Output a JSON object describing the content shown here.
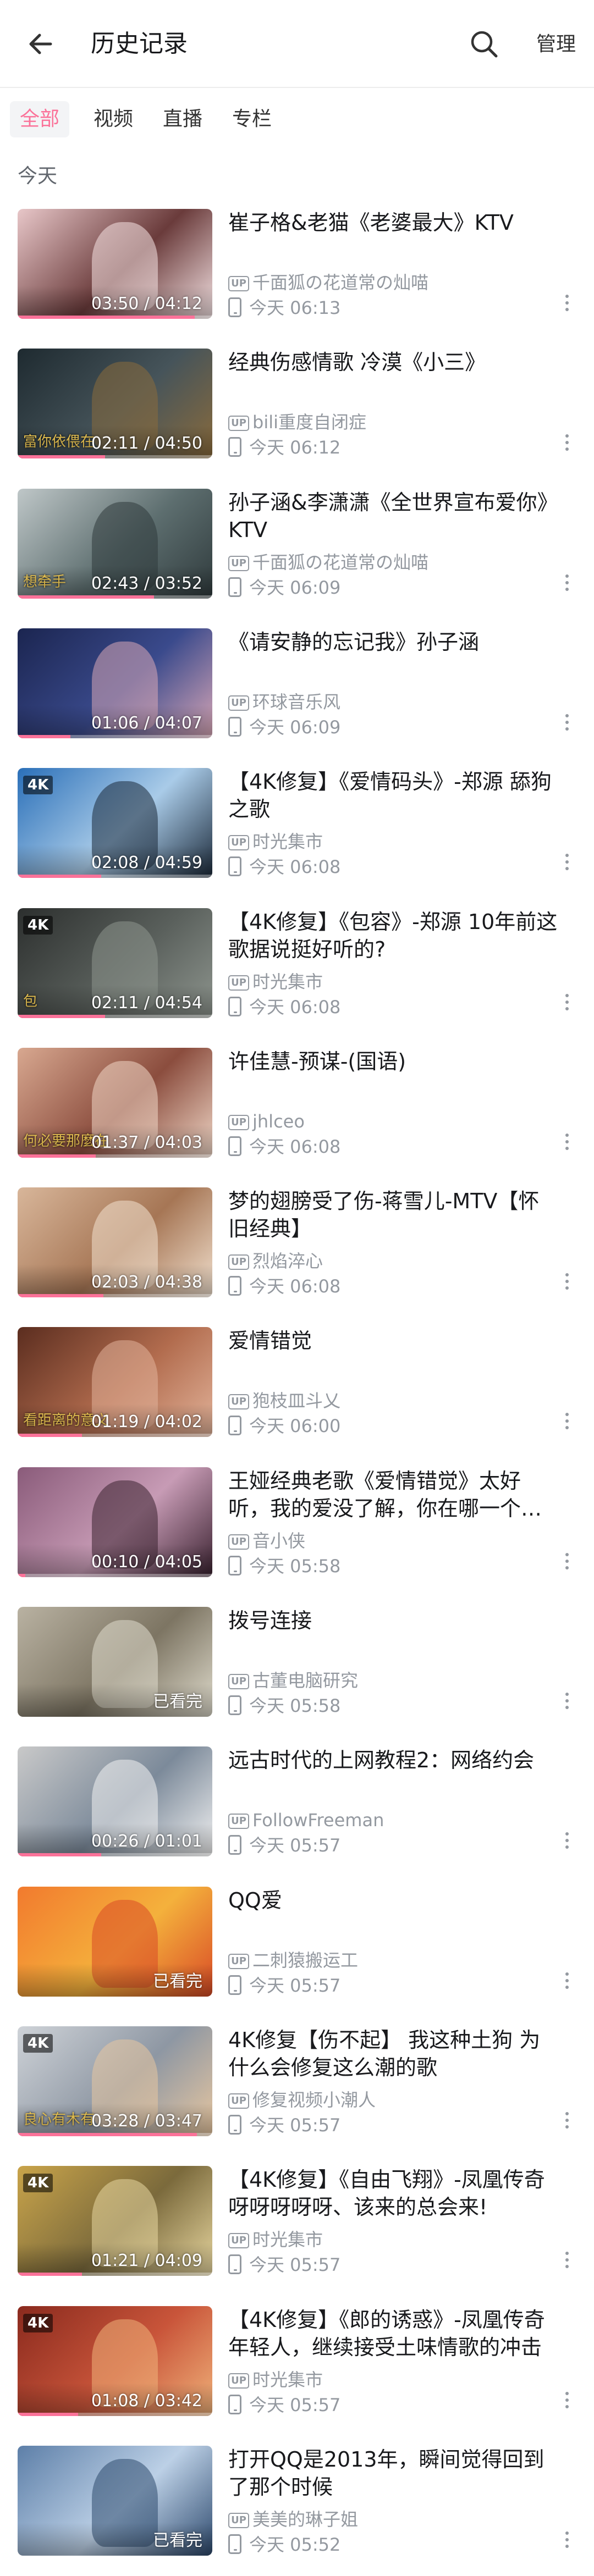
{
  "header": {
    "title": "历史记录",
    "manage_label": "管理",
    "back_icon": "arrow-left-icon",
    "search_icon": "search-icon"
  },
  "tabs": [
    {
      "label": "全部",
      "active": true
    },
    {
      "label": "视频",
      "active": false
    },
    {
      "label": "直播",
      "active": false
    },
    {
      "label": "专栏",
      "active": false
    }
  ],
  "section": {
    "label": "今天"
  },
  "colors": {
    "accent": "#fb7299",
    "meta": "#9499a0",
    "title": "#18191c"
  },
  "items": [
    {
      "title": "崔子格&老猫《老婆最大》KTV",
      "up": "千面狐の花道常の灿喵",
      "time": "今天 06:13",
      "duration": "03:50 / 04:12",
      "progress": 0.91,
      "colors": [
        "#e8c7c9",
        "#6a3b3b",
        "#f5e3e4"
      ]
    },
    {
      "title": "经典伤感情歌  冷漠《小三》",
      "up": "bili重度自闭症",
      "time": "今天 06:12",
      "duration": "02:11 / 04:50",
      "progress": 0.45,
      "colors": [
        "#1e2a30",
        "#46545a",
        "#8a6b3c"
      ],
      "caption": "富你依偎在"
    },
    {
      "title": "孙子涵&李潇潇《全世界宣布爱你》KTV",
      "up": "千面狐の花道常の灿喵",
      "time": "今天 06:09",
      "duration": "02:43 / 03:52",
      "progress": 0.7,
      "colors": [
        "#bfc7c8",
        "#5d6e6f",
        "#2f3a3c"
      ],
      "caption": "想牵手"
    },
    {
      "title": "《请安静的忘记我》孙子涵",
      "up": "环球音乐风",
      "time": "今天 06:09",
      "duration": "01:06 / 04:07",
      "progress": 0.27,
      "colors": [
        "#1b2550",
        "#3a4a8c",
        "#d9a7b6"
      ]
    },
    {
      "title": "【4K修复】《爱情码头》-郑源 舔狗之歌",
      "up": "时光集市",
      "time": "今天 06:08",
      "duration": "02:08 / 04:59",
      "progress": 0.43,
      "colors": [
        "#2a6fb8",
        "#a9cbe8",
        "#1c2a3a"
      ],
      "badge": "4K"
    },
    {
      "title": "【4K修复】《包容》-郑源 10年前这歌据说挺好听的?",
      "up": "时光集市",
      "time": "今天 06:08",
      "duration": "02:11 / 04:54",
      "progress": 0.45,
      "colors": [
        "#2c2f2e",
        "#5a605c",
        "#8e958e"
      ],
      "badge": "4K",
      "caption": "包"
    },
    {
      "title": "许佳慧-预谋-(国语)",
      "up": "jhlceo",
      "time": "今天 06:08",
      "duration": "01:37 / 04:03",
      "progress": 0.4,
      "colors": [
        "#d8a890",
        "#8b4d3e",
        "#f0d7c7"
      ],
      "caption": "何必要那麼在"
    },
    {
      "title": "梦的翅膀受了伤-蒋雪儿-MTV【怀旧经典】",
      "up": "烈焰淬心",
      "time": "今天 06:08",
      "duration": "02:03 / 04:38",
      "progress": 0.44,
      "colors": [
        "#d8b69a",
        "#a67655",
        "#f2e1cf"
      ]
    },
    {
      "title": "爱情错觉",
      "up": "狍枝皿斗乂",
      "time": "今天 06:00",
      "duration": "01:19 / 04:02",
      "progress": 0.33,
      "colors": [
        "#5b2d1f",
        "#b26c4e",
        "#e2b39a"
      ],
      "caption": "看距离的意义"
    },
    {
      "title": "王娅经典老歌《爱情错觉》太好听，我的爱没了解，你在哪一个世界",
      "up": "音小侠",
      "time": "今天 05:58",
      "duration": "00:10 / 04:05",
      "progress": 0.04,
      "colors": [
        "#8a5b7a",
        "#c79bb5",
        "#3a2230"
      ]
    },
    {
      "title": "拨号连接",
      "up": "古董电脑研究",
      "time": "今天 05:58",
      "duration": "已看完",
      "progress": 1.0,
      "colors": [
        "#b9b2a2",
        "#7d7563",
        "#e0dccd"
      ]
    },
    {
      "title": "远古时代的上网教程2：网络约会",
      "up": "FollowFreeman",
      "time": "今天 05:57",
      "duration": "00:26 / 01:01",
      "progress": 0.43,
      "colors": [
        "#c9c9c9",
        "#7c8a9a",
        "#f2f2f2"
      ]
    },
    {
      "title": "QQ爱",
      "up": "二刺猿搬运工",
      "time": "今天 05:57",
      "duration": "已看完",
      "progress": 1.0,
      "colors": [
        "#f27a2e",
        "#f4b13c",
        "#d94a26"
      ]
    },
    {
      "title": "4K修复【伤不起】 我这种土狗 为什么会修复这么潮的歌",
      "up": "修复视频小潮人",
      "time": "今天 05:57",
      "duration": "03:28 / 03:47",
      "progress": 0.92,
      "colors": [
        "#cfd3d8",
        "#8e97a3",
        "#e8c7a0"
      ],
      "badge": "4K",
      "caption": "良心有木有"
    },
    {
      "title": "【4K修复】《自由飞翔》-凤凰传奇 呀呀呀呀呀、该来的总会来!",
      "up": "时光集市",
      "time": "今天 05:57",
      "duration": "01:21 / 04:09",
      "progress": 0.33,
      "colors": [
        "#c9a44a",
        "#7b6a3c",
        "#e8d7a0"
      ],
      "badge": "4K"
    },
    {
      "title": "【4K修复】《郎的诱惑》-凤凰传奇 年轻人，继续接受土味情歌的冲击",
      "up": "时光集市",
      "time": "今天 05:57",
      "duration": "01:08 / 03:42",
      "progress": 0.31,
      "colors": [
        "#8a2a1e",
        "#c9553a",
        "#f0b27a"
      ],
      "badge": "4K"
    },
    {
      "title": "打开QQ是2013年，瞬间觉得回到了那个时候",
      "up": "美美的琳子姐",
      "time": "今天 05:52",
      "duration": "已看完",
      "progress": 1.0,
      "colors": [
        "#5d7fa8",
        "#bcd0e6",
        "#2e4a6e"
      ]
    }
  ]
}
